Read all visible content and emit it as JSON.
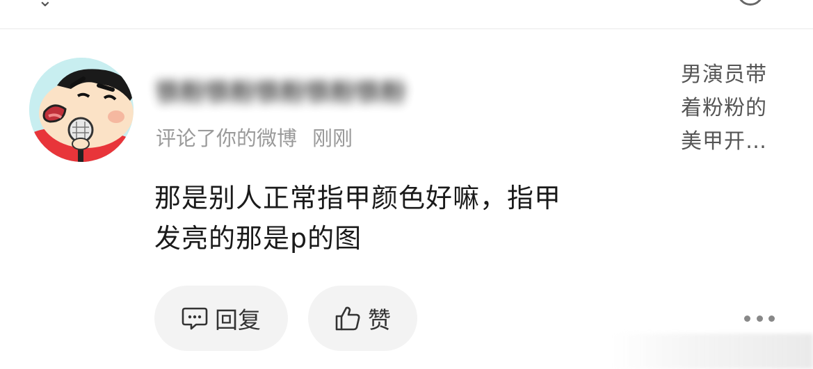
{
  "user": {
    "name": "铁粉铁粉铁粉铁粉铁粉"
  },
  "notification": {
    "action": "评论了你的微博",
    "time": "刚刚"
  },
  "post_preview": {
    "lines": [
      "男演员带",
      "着粉粉的",
      "美甲开…"
    ]
  },
  "comment": {
    "lines": [
      "那是别人正常指甲颜色好嘛，指甲",
      "发亮的那是p的图"
    ]
  },
  "actions": {
    "reply_label": "回复",
    "like_label": "赞"
  },
  "icons": {
    "avatar": "cartoon-avatar",
    "reply": "comment-bubble-icon",
    "like": "thumbs-up-icon",
    "more": "more-dots-icon"
  },
  "colors": {
    "secondary_text": "#9a9a9a",
    "pill_background": "#f3f3f3"
  }
}
